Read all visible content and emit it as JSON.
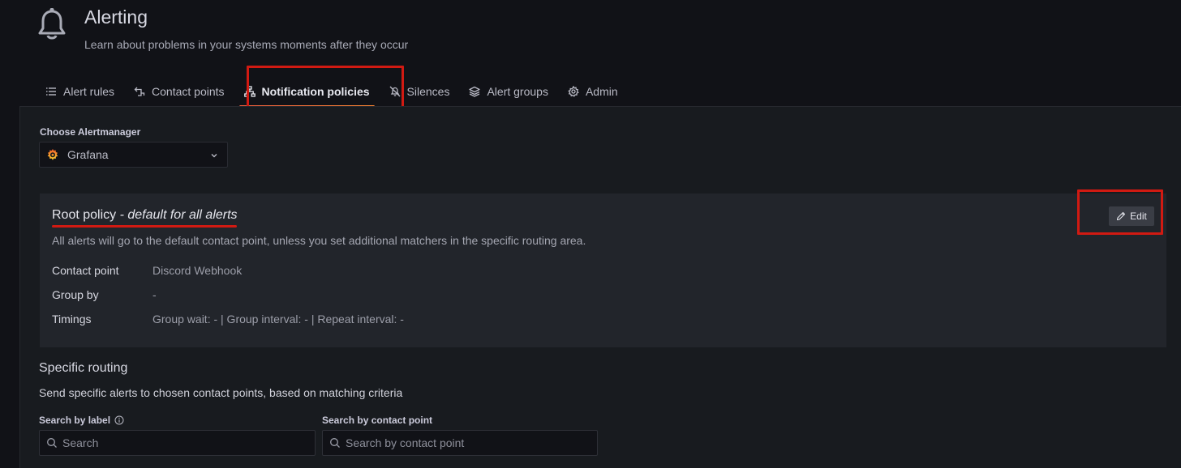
{
  "header": {
    "icon": "bell-icon",
    "title": "Alerting",
    "subtitle": "Learn about problems in your systems moments after they occur"
  },
  "tabs": [
    {
      "label": "Alert rules",
      "icon": "list-icon"
    },
    {
      "label": "Contact points",
      "icon": "contact-icon"
    },
    {
      "label": "Notification policies",
      "icon": "sitemap-icon",
      "active": true
    },
    {
      "label": "Silences",
      "icon": "bell-slash-icon"
    },
    {
      "label": "Alert groups",
      "icon": "layers-icon"
    },
    {
      "label": "Admin",
      "icon": "cog-icon"
    }
  ],
  "alertmanager": {
    "label": "Choose Alertmanager",
    "selected": "Grafana",
    "icon": "grafana-logo-icon"
  },
  "root_policy": {
    "title": "Root policy",
    "title_suffix": " - default for all alerts",
    "description": "All alerts will go to the default contact point, unless you set additional matchers in the specific routing area.",
    "edit_label": "Edit",
    "rows": [
      {
        "label": "Contact point",
        "value": "Discord Webhook"
      },
      {
        "label": "Group by",
        "value": "-"
      },
      {
        "label": "Timings",
        "value": "Group wait: - | Group interval: - | Repeat interval: -"
      }
    ]
  },
  "specific_routing": {
    "title": "Specific routing",
    "description": "Send specific alerts to chosen contact points, based on matching criteria",
    "search_label": "Search by label",
    "search_placeholder": "Search",
    "contact_label": "Search by contact point",
    "contact_placeholder": "Search by contact point"
  },
  "colors": {
    "highlight_red": "#d11a12",
    "tab_underline": "#f55f3e",
    "background": "#111217",
    "panel": "#181b1f",
    "card": "#22252b"
  }
}
